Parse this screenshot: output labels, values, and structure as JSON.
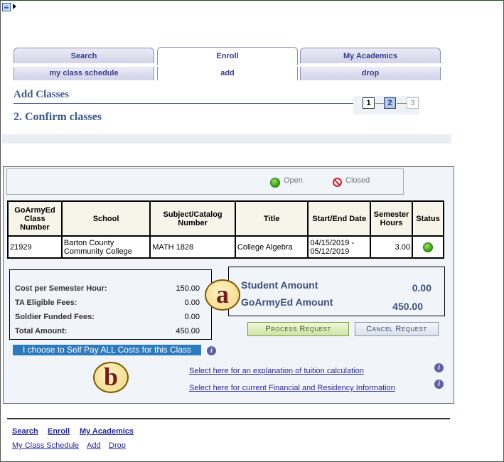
{
  "tabs": [
    {
      "label": "Search",
      "active": false
    },
    {
      "label": "Enroll",
      "active": true
    },
    {
      "label": "My Academics",
      "active": false
    }
  ],
  "subtabs": [
    {
      "label": "my class schedule",
      "active": false
    },
    {
      "label": "add",
      "active": true
    },
    {
      "label": "drop",
      "active": false
    }
  ],
  "page": {
    "heading": "Add Classes",
    "subheading": "2. Confirm classes",
    "steps": [
      "1",
      "2",
      "3"
    ],
    "current_step": 2
  },
  "legend": {
    "open_label": "Open",
    "closed_label": "Closed"
  },
  "table": {
    "headers": [
      "GoArmyEd Class Number",
      "School",
      "Subject/Catalog Number",
      "Title",
      "Start/End Date",
      "Semester Hours",
      "Status"
    ],
    "rows": [
      {
        "class_number": "21929",
        "school": "Barton County Community College",
        "subject": "MATH 1828",
        "title": "College Algebra",
        "dates": "04/15/2019 - 05/12/2019",
        "hours": "3.00",
        "status": "open-icon"
      }
    ]
  },
  "fees": [
    {
      "label": "Cost per Semester Hour:",
      "value": "150.00"
    },
    {
      "label": "TA Eligible Fees:",
      "value": "0.00"
    },
    {
      "label": "Soldier Funded Fees:",
      "value": "0.00"
    },
    {
      "label": "Total Amount:",
      "value": "450.00"
    }
  ],
  "amounts": {
    "student_label": "Student Amount",
    "student_value": "0.00",
    "goarmyed_label": "GoArmyEd Amount",
    "goarmyed_value": "450.00"
  },
  "markers": {
    "a": "a",
    "b": "b"
  },
  "buttons": {
    "process": "Process Request",
    "cancel": "Cancel Request"
  },
  "selfpay_label": "I choose to Self Pay ALL Costs for this Class",
  "links": {
    "tuition": "Select here for an explanation of tuition calculation",
    "financial": "Select here for current Financial and Residency Information"
  },
  "footer": {
    "row1": [
      "Search",
      "Enroll",
      "My Academics"
    ],
    "row2": [
      "My Class Schedule",
      "Add",
      "Drop"
    ]
  },
  "colors": {
    "heading": "#3e5a87",
    "link": "#25279a",
    "selfpay_bg": "#2c7bbf",
    "open_green": "#3aa412",
    "closed_red": "#d52020"
  }
}
